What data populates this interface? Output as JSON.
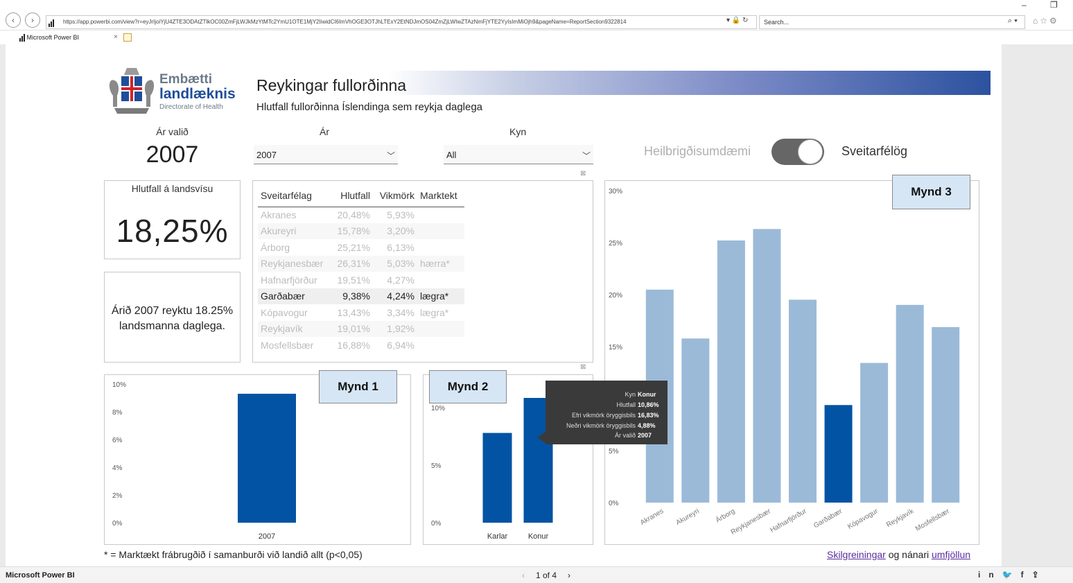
{
  "browser": {
    "url": "https://app.powerbi.com/view?r=eyJrIjoiYjU4ZTE3ODAtZTlkOC00ZmFjLWJkMzYtMTc2YmU1OTE1MjY2IiwidCI6ImVhOGE3OTJhLTExY2EtNDJmOS04ZmZjLWIwZTAzNmFjYTE2YyIsImMiOjh9&pageName=ReportSection9322814",
    "search_placeholder": "Search...",
    "tab_title": "Microsoft Power BI",
    "back_icon": "back-arrow-icon",
    "forward_icon": "forward-arrow-icon"
  },
  "logo": {
    "line1": "Embætti",
    "line2": "landlæknis",
    "line3": "Directorate of Health"
  },
  "header": {
    "title": "Reykingar fullorðinna",
    "subtitle": "Hlutfall fullorðinna Íslendinga sem reykja daglega"
  },
  "filters": {
    "year_selected_label": "Ár valið",
    "year_selected_value": "2007",
    "year_label": "Ár",
    "year_value": "2007",
    "sex_label": "Kyn",
    "sex_value": "All"
  },
  "toggle": {
    "left_label": "Heilbrigðisumdæmi",
    "right_label": "Sveitarfélög",
    "state": "on"
  },
  "national": {
    "title": "Hlutfall á landsvísu",
    "value": "18,25%"
  },
  "narrative": "Árið 2007 reyktu 18.25% landsmanna daglega.",
  "table": {
    "columns": [
      "Sveitarfélag",
      "Hlutfall",
      "Vikmörk",
      "Marktekt"
    ],
    "rows": [
      [
        "Akranes",
        "20,48%",
        "5,93%",
        ""
      ],
      [
        "Akureyri",
        "15,78%",
        "3,20%",
        ""
      ],
      [
        "Árborg",
        "25,21%",
        "6,13%",
        ""
      ],
      [
        "Reykjanesbær",
        "26,31%",
        "5,03%",
        "hærra*"
      ],
      [
        "Hafnarfjörður",
        "19,51%",
        "4,27%",
        ""
      ],
      [
        "Garðabær",
        "9,38%",
        "4,24%",
        "lægra*"
      ],
      [
        "Kópavogur",
        "13,43%",
        "3,34%",
        "lægra*"
      ],
      [
        "Reykjavík",
        "19,01%",
        "1,92%",
        ""
      ],
      [
        "Mosfellsbær",
        "16,88%",
        "6,94%",
        ""
      ]
    ],
    "highlighted_row": 5
  },
  "labels": {
    "mynd1": "Mynd 1",
    "mynd2": "Mynd 2",
    "mynd3": "Mynd 3"
  },
  "tooltip": {
    "rows": [
      {
        "key": "Kyn",
        "value": "Konur"
      },
      {
        "key": "Hlutfall",
        "value": "10,86%"
      },
      {
        "key": "Efri vikmörk öryggisbils",
        "value": "16,83%"
      },
      {
        "key": "Neðri vikmörk öryggisbils",
        "value": "4,88%"
      },
      {
        "key": "Ár valið",
        "value": "2007"
      }
    ]
  },
  "footer": {
    "footnote": "* = Marktækt frábrugðið í samanburði við landið allt (p<0,05)",
    "link1": "Skilgreiningar",
    "link_mid": " og nánari ",
    "link2": "umfjöllun"
  },
  "status": {
    "app": "Microsoft Power BI",
    "page_indicator": "1 of 4",
    "prev": "‹",
    "next": "›"
  },
  "colors": {
    "dark_blue": "#0353a4",
    "light_blue": "#9bbad8",
    "tooltip_bg": "#3a3a3a",
    "mynd_box": "#d6e6f5"
  },
  "chart_data": [
    {
      "type": "bar",
      "name": "Mynd 1",
      "categories": [
        "2007"
      ],
      "values": [
        9.38
      ],
      "ylim": [
        0,
        10
      ],
      "yticks": [
        "0%",
        "2%",
        "4%",
        "6%",
        "8%",
        "10%"
      ],
      "ytick_values": [
        0,
        2,
        4,
        6,
        8,
        10
      ],
      "grid": false
    },
    {
      "type": "bar",
      "name": "Mynd 2",
      "categories": [
        "Karlar",
        "Konur"
      ],
      "values": [
        7.8,
        10.86
      ],
      "ylim": [
        0,
        10
      ],
      "yticks": [
        "0%",
        "5%",
        "10%"
      ],
      "ytick_values": [
        0,
        5,
        10
      ],
      "grid": false
    },
    {
      "type": "bar",
      "name": "Mynd 3",
      "categories": [
        "Akranes",
        "Akureyri",
        "Árborg",
        "Reykjanesbær",
        "Hafnarfjörður",
        "Garðabær",
        "Kópavogur",
        "Reykjavík",
        "Mosfellsbær"
      ],
      "values": [
        20.48,
        15.78,
        25.21,
        26.31,
        19.51,
        9.38,
        13.43,
        19.01,
        16.88
      ],
      "highlight_index": 5,
      "ylim": [
        0,
        30
      ],
      "yticks": [
        "0%",
        "5%",
        "15%",
        "20%",
        "25%",
        "30%"
      ],
      "ytick_values": [
        0,
        5,
        15,
        20,
        25,
        30
      ],
      "grid": false
    }
  ]
}
